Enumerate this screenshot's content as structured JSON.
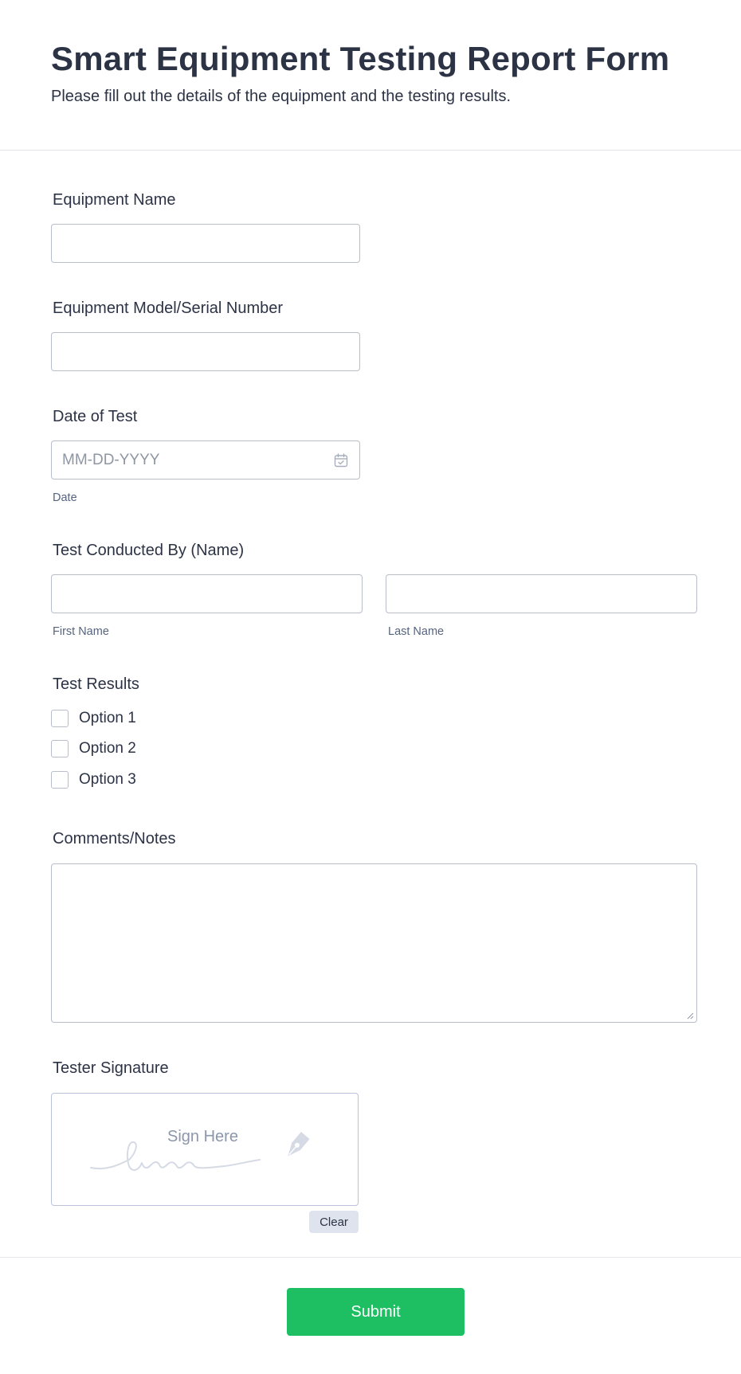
{
  "header": {
    "title": "Smart Equipment Testing Report Form",
    "subtitle": "Please fill out the details of the equipment and the testing results."
  },
  "fields": {
    "equipment_name": {
      "label": "Equipment Name",
      "value": ""
    },
    "model_serial": {
      "label": "Equipment Model/Serial Number",
      "value": ""
    },
    "date_of_test": {
      "label": "Date of Test",
      "placeholder": "MM-DD-YYYY",
      "sublabel": "Date",
      "icon": "calendar-icon"
    },
    "conducted_by": {
      "label": "Test Conducted By (Name)",
      "first_sublabel": "First Name",
      "last_sublabel": "Last Name"
    },
    "test_results": {
      "label": "Test Results",
      "options": [
        "Option 1",
        "Option 2",
        "Option 3"
      ]
    },
    "comments": {
      "label": "Comments/Notes",
      "value": ""
    },
    "signature": {
      "label": "Tester Signature",
      "placeholder": "Sign Here",
      "clear_label": "Clear",
      "icon": "pen-nib-icon"
    }
  },
  "actions": {
    "submit_label": "Submit"
  },
  "colors": {
    "text": "#2c3345",
    "input_border": "#b8bdc9",
    "submit_bg": "#1dbf62",
    "clear_bg": "#dfe3ee"
  }
}
